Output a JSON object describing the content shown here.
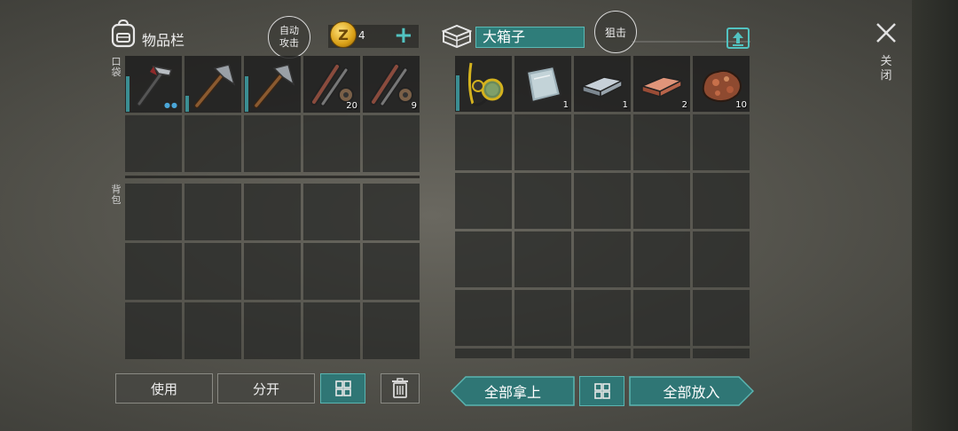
{
  "inventory": {
    "title": "物品栏",
    "auto_attack": [
      "自动",
      "攻击"
    ],
    "coins": "4",
    "pocket_label": "口袋",
    "backpack_label": "背包",
    "pocket_items": [
      {
        "icon": "hammer-icon",
        "count": "",
        "durability": true,
        "dots": "●●"
      },
      {
        "icon": "pickaxe-icon",
        "count": "",
        "durability": true,
        "dots": ""
      },
      {
        "icon": "pickaxe-icon",
        "count": "",
        "durability": true,
        "dots": ""
      },
      {
        "icon": "fishing-rod-parts-icon",
        "count": "20",
        "durability": false,
        "dots": ""
      },
      {
        "icon": "fishing-rod-parts-icon",
        "count": "9",
        "durability": false,
        "dots": ""
      }
    ]
  },
  "chest": {
    "name": "大箱子",
    "sniper": "狙击",
    "items": [
      {
        "icon": "goggles-icon",
        "count": ""
      },
      {
        "icon": "glass-plate-icon",
        "count": "1"
      },
      {
        "icon": "iron-ingot-icon",
        "count": "1"
      },
      {
        "icon": "copper-ingot-icon",
        "count": "2"
      },
      {
        "icon": "copper-ore-icon",
        "count": "10"
      }
    ]
  },
  "close_label": "关闭",
  "buttons": {
    "use": "使用",
    "split": "分开",
    "take_all": "全部拿上",
    "put_all": "全部放入"
  },
  "colors": {
    "accent": "#2f7675",
    "accent_light": "#52c3c1",
    "durability": "#3b8e93"
  }
}
